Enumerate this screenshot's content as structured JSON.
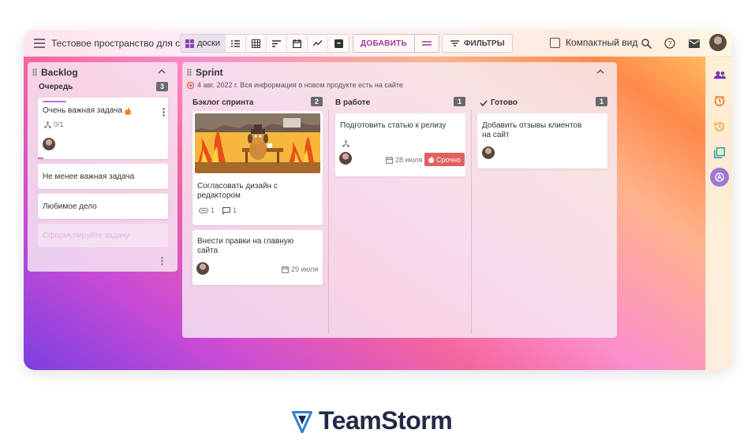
{
  "topbar": {
    "space_title": "Тестовое пространство для с...",
    "boards_label": "ДОСКИ",
    "add_label": "ДОБАВИТЬ",
    "filters_label": "ФИЛЬТРЫ",
    "compact_label": "Компактный вид"
  },
  "backlog": {
    "title": "Backlog",
    "queue_label": "Очередь",
    "queue_count": "3",
    "cards": [
      {
        "title": "Очень важная задача",
        "subtasks": "0/1"
      },
      {
        "title": "Не менее важная задача"
      },
      {
        "title": "Любимое дело"
      }
    ],
    "new_task_placeholder": "Сформулируйте задачу"
  },
  "sprint": {
    "title": "Sprint",
    "info": "4 авг. 2022 г. Вся информация о новом продукте есть на сайте",
    "columns": [
      {
        "title": "Бэклог спринта",
        "count": "2",
        "cards": [
          {
            "title": "Согласовать дизайн с редактором",
            "attachments": "1",
            "comments": "1"
          },
          {
            "title": "Внести правки на главную сайта",
            "date": "29 июля"
          }
        ]
      },
      {
        "title": "В работе",
        "count": "1",
        "cards": [
          {
            "title": "Подготовить статью к релизу",
            "date": "28 июля",
            "badge": "Срочно"
          }
        ]
      },
      {
        "title": "Готово",
        "count": "1",
        "cards": [
          {
            "title": "Добавить отзывы клиентов на сайт"
          }
        ]
      }
    ]
  },
  "brand": {
    "name": "TeamStorm"
  },
  "colors": {
    "accent": "#9c3a9e",
    "urgent": "#e0605f",
    "brand": "#1f2a44"
  }
}
